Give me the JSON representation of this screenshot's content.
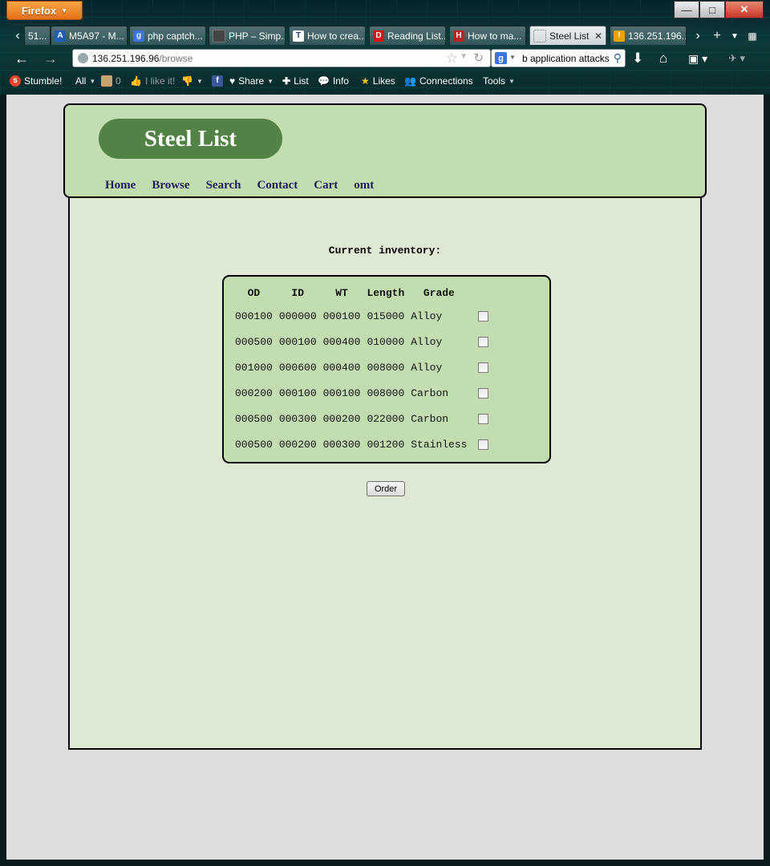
{
  "browser": {
    "app_button": "Firefox",
    "tabs": [
      {
        "label": "51...",
        "favicon": "",
        "color": "#666"
      },
      {
        "label": "M5A97 - M...",
        "favicon": "A",
        "color": "#1f5fb8"
      },
      {
        "label": "php captch...",
        "favicon": "g",
        "color": "#3b73e0"
      },
      {
        "label": "PHP – Simp...",
        "favicon": "",
        "color": "#444"
      },
      {
        "label": "How to crea...",
        "favicon": "T",
        "color": "#ffffff"
      },
      {
        "label": "Reading List...",
        "favicon": "D",
        "color": "#d11"
      },
      {
        "label": "How to ma...",
        "favicon": "H",
        "color": "#b22"
      },
      {
        "label": "Steel List",
        "favicon": "",
        "color": "#ccc"
      },
      {
        "label": "136.251.196....",
        "favicon": "!",
        "color": "#e8a400"
      }
    ],
    "url_host": "136.251.196.96",
    "url_path": "/browse",
    "search_text": "b application attacks"
  },
  "toolbar": {
    "stumble": "Stumble!",
    "all": "All",
    "count": "0",
    "like": "I like it!",
    "share": "Share",
    "list": "List",
    "info": "Info",
    "likes": "Likes",
    "connections": "Connections",
    "tools": "Tools"
  },
  "site": {
    "title": "Steel List",
    "nav": [
      "Home",
      "Browse",
      "Search",
      "Contact",
      "Cart",
      "omt"
    ]
  },
  "inventory": {
    "heading": "Current inventory:",
    "columns": [
      "OD",
      "ID",
      "WT",
      "Length",
      "Grade"
    ],
    "rows": [
      [
        "000100",
        "000000",
        "000100",
        "015000",
        "Alloy"
      ],
      [
        "000500",
        "000100",
        "000400",
        "010000",
        "Alloy"
      ],
      [
        "001000",
        "000600",
        "000400",
        "008000",
        "Alloy"
      ],
      [
        "000200",
        "000100",
        "000100",
        "008000",
        "Carbon"
      ],
      [
        "000500",
        "000300",
        "000200",
        "022000",
        "Carbon"
      ],
      [
        "000500",
        "000200",
        "000300",
        "001200",
        "Stainless"
      ]
    ],
    "order_label": "Order"
  }
}
